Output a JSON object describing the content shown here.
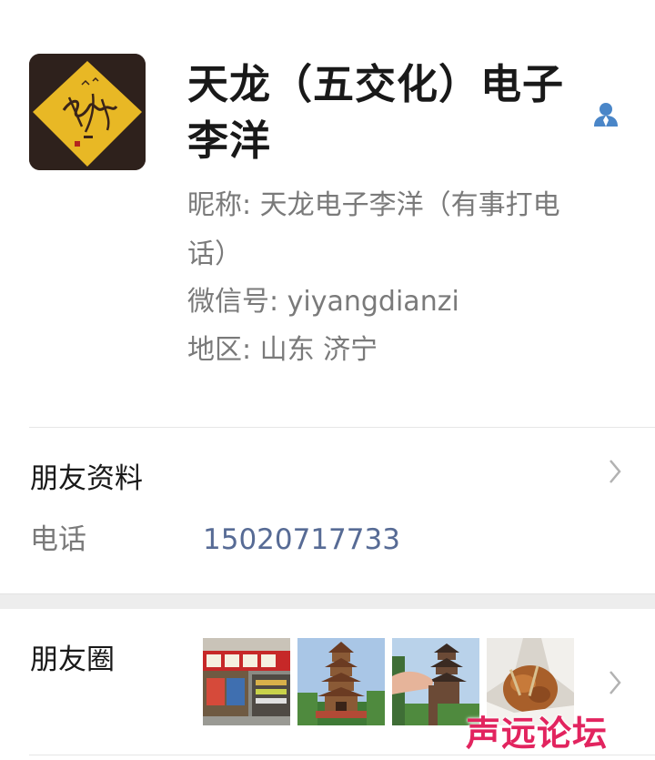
{
  "profile": {
    "display_name": "天龙（五交化）电子李洋",
    "nickname_line": "昵称: 天龙电子李洋（有事打电话）",
    "nickname_line_1": "昵称: 天龙电子李洋（有事打电",
    "nickname_line_2": "话）",
    "wechat_id_line": "微信号: yiyangdianzi",
    "region_line": "地区: 山东  济宁",
    "avatar_icon": "signature-avatar",
    "contact_icon": "person-icon"
  },
  "friend_info": {
    "title": "朋友资料",
    "phone_label": "电话",
    "phone_value": "15020717733"
  },
  "moments": {
    "title": "朋友圈",
    "thumbnails": [
      {
        "icon": "shop-storefront-photo"
      },
      {
        "icon": "pagoda-tower-photo"
      },
      {
        "icon": "pagoda-with-hand-photo"
      },
      {
        "icon": "food-bag-photo"
      }
    ]
  },
  "watermark": {
    "text": "声远论坛"
  },
  "colors": {
    "link": "#576b95",
    "secondary_text": "#7a7a7a",
    "watermark": "#e2245f",
    "contact_icon": "#4a86c8"
  }
}
